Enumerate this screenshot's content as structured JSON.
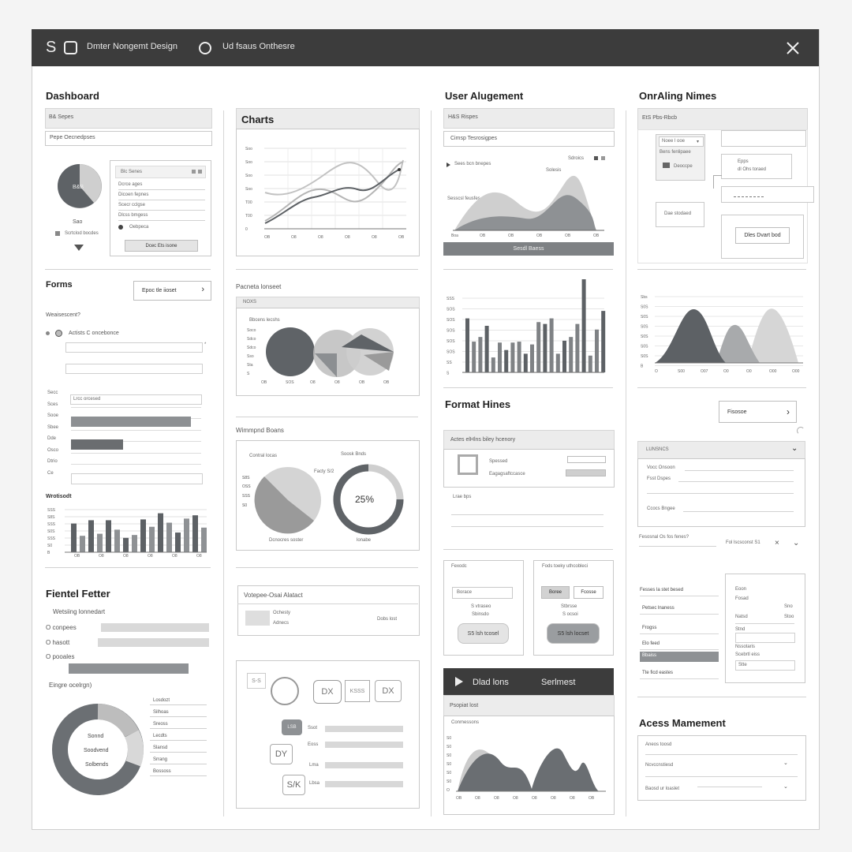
{
  "topbar": {
    "title": "Dmter Nongemt Design",
    "subtitle": "Ud fsaus Onthesre"
  },
  "col1": {
    "dashboard_title": "Dashboard",
    "dashboard_bar": "B& Sepes",
    "dashboard_field": "Pepe Oecnedpses",
    "pie_center": "B&B",
    "pie_caption": "Sao",
    "pie_note": "Scrtclod bocdes",
    "list_header": "Blc Senes",
    "list_items": [
      "Dcrce ages",
      "Dicoen fepnes",
      "Scecr cclgse",
      "Dlcss bmgess",
      "Oebpeca"
    ],
    "list_button": "Dcec Ets isone",
    "forms_title": "Forms",
    "forms_button": "Epoc tle iioset",
    "forms_question": "Weaisescent?",
    "forms_radio": "Actists C oncebonce",
    "hbars_label": "Lrcc orcesed",
    "hbars_ticks": [
      "Secc",
      "Sces",
      "Sooe",
      "Sbee",
      "Dde",
      "Osco",
      "Dtrio",
      "Ce"
    ],
    "hbars_values": [
      0.92,
      0.4
    ],
    "barchart_title": "Wrotisodt",
    "barchart_yticks": [
      "SSS",
      "S8S",
      "SSS",
      "S0S",
      "SSS",
      "S0",
      "B"
    ],
    "barchart_xticks": [
      "OB",
      "O8",
      "O8",
      "O8",
      "O8",
      "O8"
    ],
    "filter_title": "Fientel Fetter",
    "filter_subtitle": "Wetsiing lonnedart",
    "filter_rows": [
      "O conpees",
      "O hasott",
      "O pooales"
    ],
    "donut_title": "Eingre ocelrgn)",
    "donut_center": [
      "Sonnd",
      "Soodvend",
      "Solbends"
    ],
    "donut_legend": [
      "Losdozt",
      "Silhoas",
      "Sreoss",
      "Lecdts",
      "Slansd",
      "Srrang",
      "Bossoss"
    ]
  },
  "col2": {
    "charts_title": "Charts",
    "line_yticks": [
      "Soo",
      "Soo",
      "Soo",
      "Soo",
      "T00",
      "T00",
      "0"
    ],
    "line_xticks": [
      "OB",
      "O8",
      "O8",
      "O8",
      "O8",
      "OB"
    ],
    "venn_title": "Pacneta lonseet",
    "venn_bar": "NOXS",
    "venn_chart_label": "Bbcens lecshs",
    "venn_yticks": [
      "Soco",
      "Sdco",
      "Sdco",
      "Sso",
      "Sta",
      "S"
    ],
    "venn_xticks": [
      "OB",
      "SOS",
      "O8",
      "O8",
      "OB",
      "OB"
    ],
    "pie_section_title": "Wimmpnd Boans",
    "pie_left_label": "Contral locas",
    "pie_right_label": "Soosk Bnds",
    "pie_tag": "Facty S/2",
    "pie_yticks": [
      "S8S",
      "OSS",
      "SSS",
      "S0"
    ],
    "pie_left_caption": "Dcnocres soster",
    "pie_right_caption": "lonabe",
    "ring_percent": "25%",
    "alert_title": "Votepee-Osai Alatact",
    "alert_lines": [
      "Ochesty",
      "Adnecs"
    ],
    "alert_action": "Dobs lost",
    "icon_tags": [
      "S-S",
      "DX",
      "KSSS",
      "DX",
      "LSB",
      "DY",
      "S/K"
    ],
    "icon_rows": [
      "Ssot",
      "Eoss",
      "Lma",
      "Lbsa"
    ]
  },
  "col3": {
    "user_title": "User Alugement",
    "user_bar": "H&S Rispes",
    "user_field": "Cimsp Tesrosigpes",
    "user_legend": "Sdroics",
    "user_item": "Sees bcn bnepes",
    "user_chart_label": "Solesis",
    "user_chart_note": "Sesscsl feusfes",
    "user_xticks": [
      "Boa",
      "OB",
      "OB",
      "OB",
      "OB",
      "OB"
    ],
    "user_button": "Sesdl Baess",
    "bars_yticks": [
      "SSS",
      "SOS",
      "SOS",
      "SOS",
      "SOS",
      "SOS",
      "SS",
      "S"
    ],
    "bars_values": [
      0.58,
      0.33,
      0.38,
      0.5,
      0.16,
      0.32,
      0.24,
      0.32,
      0.33,
      0.2,
      0.3,
      0.54,
      0.52,
      0.58,
      0.2,
      0.34,
      0.38,
      0.52,
      1.0,
      0.18,
      0.46,
      0.66
    ],
    "format_title": "Format Hines",
    "format_bar": "Actes elHlns biley hcenory",
    "format_labels": [
      "Spessed",
      "Eagagsaftccasce"
    ],
    "format_subhead": "Lrae bps",
    "card_left_title": "Fexodc",
    "card_left_field": "Borace",
    "card_left_lines": [
      "S vtraseo",
      "Sbinsdo"
    ],
    "card_left_button": "S5 lsh tcosel",
    "card_right_title": "Fods toeky uthcobleci",
    "card_right_fields": [
      "Boree",
      "Fcosse"
    ],
    "card_right_lines": [
      "Stbrsse",
      "S ocsoi"
    ],
    "card_right_button": "S5 lsh locset",
    "media_play": "Dlad lons",
    "media_title": "Serlmest",
    "media_sub": "Psopiat lost",
    "media_chart_label": "Conmessons",
    "media_yticks": [
      "S0",
      "S0",
      "S0",
      "S0",
      "S0",
      "S0",
      "O"
    ],
    "media_xticks": [
      "OB",
      "O8",
      "O8",
      "O8",
      "O8",
      "O8",
      "O8",
      "OB"
    ]
  },
  "col4": {
    "onboard_title": "OnrAling Nimes",
    "onboard_bar": "EtS Pbs-Rbcb",
    "flow_nodes": [
      "Noee l ooe",
      "Bens fenlipaee",
      "Deoccpe",
      "Epps",
      "dl Ohs toraed",
      "Dae stodaed",
      "Dles Dvart bod"
    ],
    "dist_yticks": [
      "Sbs",
      "S0S",
      "S0S",
      "S0S",
      "S0S",
      "S0S",
      "S0S",
      "B"
    ],
    "dist_xticks": [
      "O",
      "S00",
      "O07",
      "O0",
      "O0",
      "O00",
      "O00"
    ],
    "filter_button": "Fisosoe",
    "accordion_title": "LUNSNCS",
    "accordion_items": [
      "Vocc Onsoon",
      "Fsst Dspes",
      "Ccocs Bngee"
    ],
    "search_label": "Fesosnal Os fos fenes?",
    "search_value": "Fol lscsconst S1",
    "list_items": [
      "Fesses la stet besed",
      "Petsec lnaness",
      "Frogss",
      "Elo feed",
      "Bocbaiss",
      "Tte ficd eastes"
    ],
    "list_selected": "Bbaiss",
    "panel_title": "Eoon",
    "panel_lines": [
      "Fosad",
      "Natsd",
      "Stnd",
      "Nssotaris",
      "Scebrtl eiss"
    ],
    "panel_mini": [
      "Sno",
      "Stoo"
    ],
    "panel_field": "Stte",
    "access_title": "Acess Mamement",
    "access_rows": [
      "Aneos toosd",
      "Ncvccnstiesd",
      "Baosd ur loaslet"
    ]
  }
}
